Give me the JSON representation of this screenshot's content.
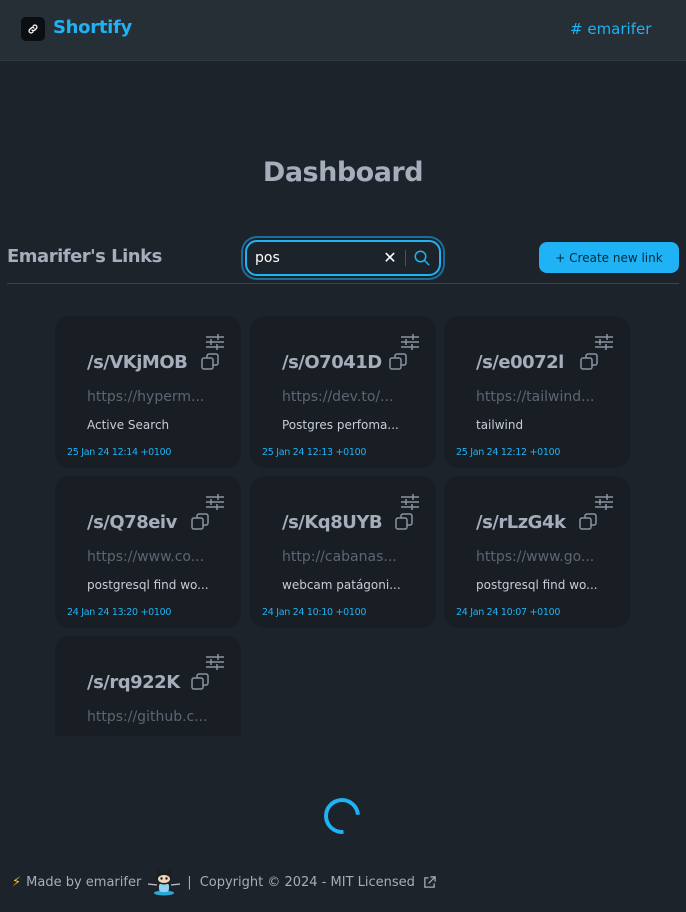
{
  "app": {
    "brand": "Shortify",
    "user_link": "# emarifer"
  },
  "dashboard": {
    "title": "Dashboard",
    "section_title": "Emarifer's Links",
    "search": {
      "value": "pos",
      "placeholder": ""
    },
    "create_button": "+ Create new link"
  },
  "links": [
    {
      "short": "/s/VKjMOB",
      "url": "https://hyperm...",
      "description": "Active Search",
      "date": "25 Jan 24 12:14 +0100"
    },
    {
      "short": "/s/O7041D",
      "url": "https://dev.to/...",
      "description": "Postgres perfoma...",
      "date": "25 Jan 24 12:13 +0100"
    },
    {
      "short": "/s/e0072l",
      "url": "https://tailwind...",
      "description": "tailwind",
      "date": "25 Jan 24 12:12 +0100"
    },
    {
      "short": "/s/Q78eiv",
      "url": "https://www.co...",
      "description": "postgresql find wo...",
      "date": "24 Jan 24 13:20 +0100"
    },
    {
      "short": "/s/Kq8UYB",
      "url": "http://cabanas...",
      "description": "webcam patágoni...",
      "date": "24 Jan 24 10:10 +0100"
    },
    {
      "short": "/s/rLzG4k",
      "url": "https://www.go...",
      "description": "postgresql find wo...",
      "date": "24 Jan 24 10:07 +0100"
    },
    {
      "short": "/s/rq922K",
      "url": "https://github.c...",
      "description": "",
      "date": ""
    }
  ],
  "footer": {
    "made_by": "Made by emarifer",
    "copyright": "Copyright © 2024 - MIT Licensed"
  },
  "colors": {
    "accent": "#1fb2f5",
    "background": "#1d232a",
    "card": "#191e24",
    "navbar": "#262e36"
  }
}
